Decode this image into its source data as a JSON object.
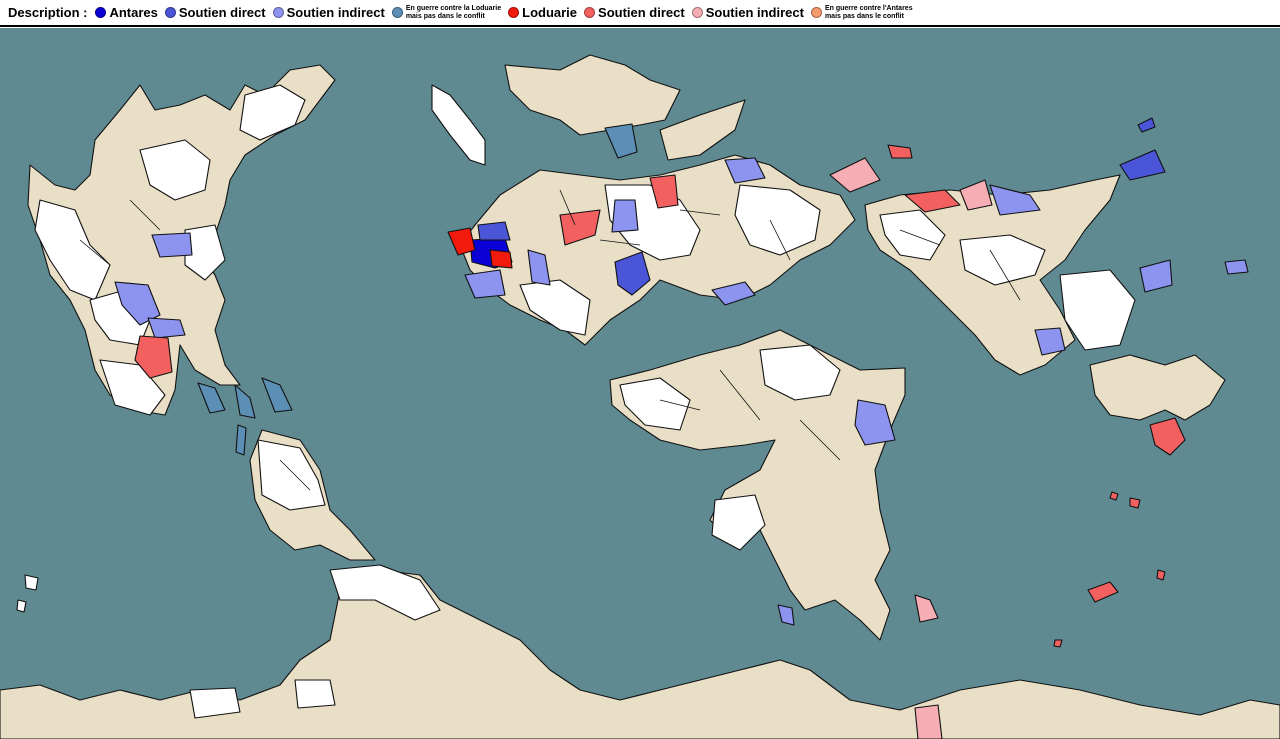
{
  "legend": {
    "title": "Description :",
    "items": [
      {
        "label": "Antares",
        "color": "#0a00d6",
        "size": "normal"
      },
      {
        "label": "Soutien direct",
        "color": "#4a55d8",
        "size": "normal"
      },
      {
        "label": "Soutien indirect",
        "color": "#8c94f0",
        "size": "normal"
      },
      {
        "label": "En guerre contre la Loduarie\nmais pas dans le conflit",
        "color": "#5b8fb5",
        "size": "small"
      },
      {
        "label": "Loduarie",
        "color": "#f21a0c",
        "size": "normal"
      },
      {
        "label": "Soutien direct",
        "color": "#f26060",
        "size": "normal"
      },
      {
        "label": "Soutien indirect",
        "color": "#f6adb4",
        "size": "normal"
      },
      {
        "label": "En guerre contre l'Antares\nmais pas dans le conflit",
        "color": "#f79a6c",
        "size": "small"
      }
    ]
  },
  "map": {
    "ocean_color": "#5f8a91",
    "neutral_color": "#ffffff",
    "unclaimed_color": "#e8dfc6"
  }
}
